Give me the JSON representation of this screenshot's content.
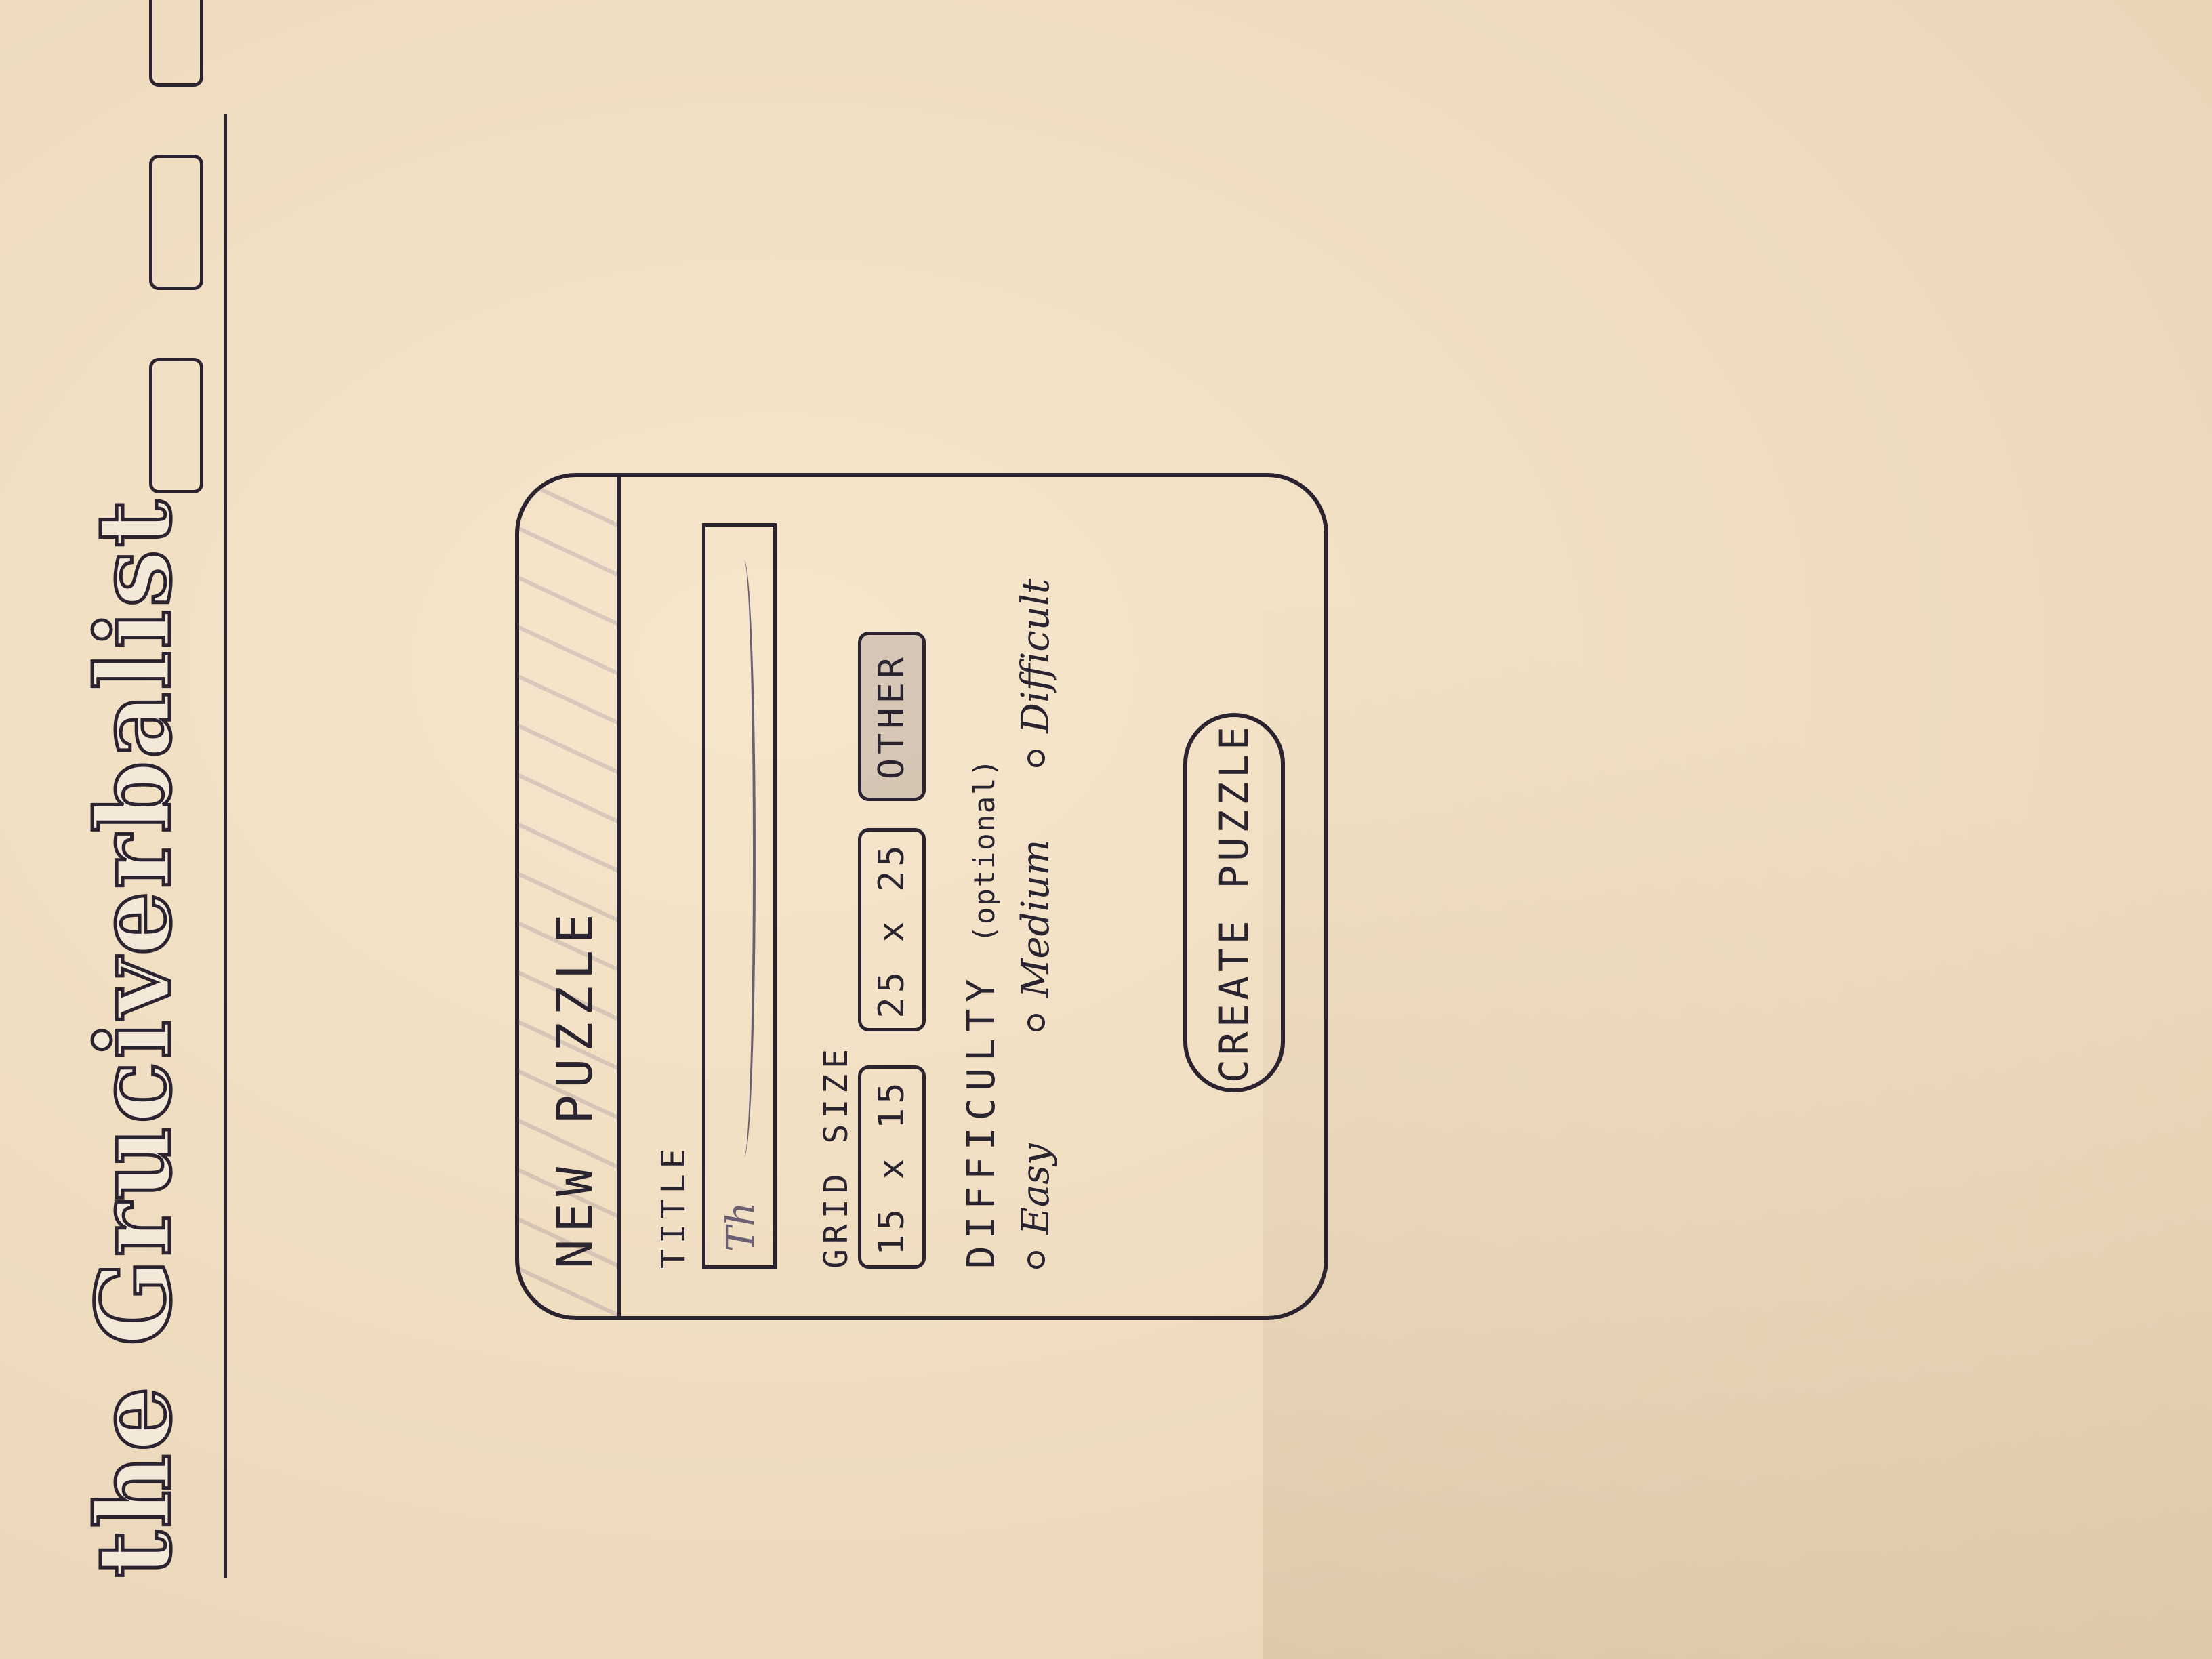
{
  "app": {
    "brand": "the Gruciverbalist"
  },
  "header": {
    "nav_icons": [
      "nav-box-icon",
      "nav-box-icon",
      "nav-box-icon"
    ]
  },
  "modal": {
    "title": "NEW PUZZLE",
    "title_field": {
      "label": "TITLE",
      "value": "Th"
    },
    "grid_size": {
      "label": "GRID SIZE",
      "options": [
        "15 x 15",
        "25 x 25",
        "OTHER"
      ],
      "selected": "OTHER"
    },
    "difficulty": {
      "label": "DIFFICULTY",
      "label_note": "(optional)",
      "options": [
        "Easy",
        "Medium",
        "Difficult"
      ]
    },
    "create_button": "CREATE PUZZLE"
  },
  "colors": {
    "paper": "#efdcbf",
    "ink": "#2b2430"
  }
}
